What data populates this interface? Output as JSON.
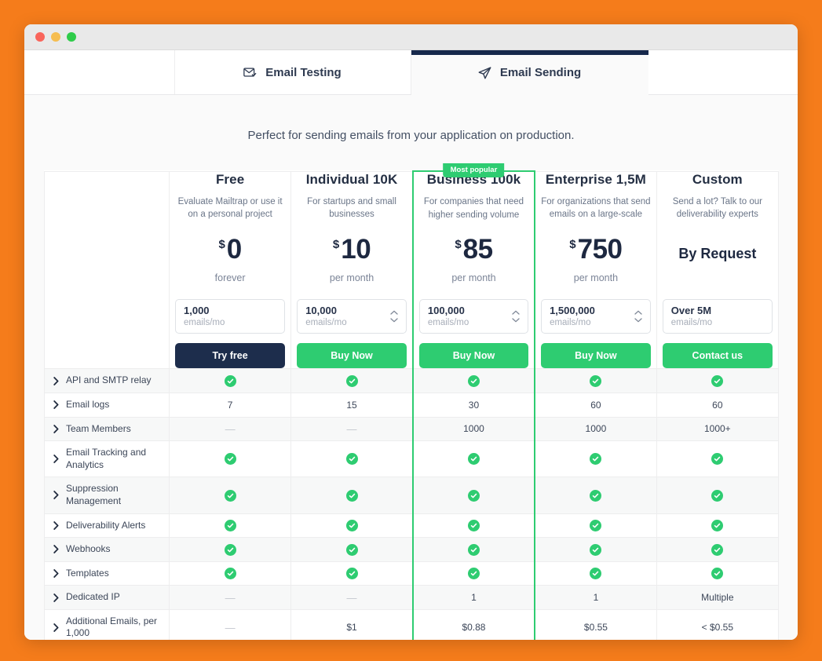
{
  "window": {
    "traffic_lights": [
      "close",
      "minimize",
      "maximize"
    ]
  },
  "tabs": [
    {
      "label": "Email Testing",
      "icon": "mail-check-icon",
      "active": false
    },
    {
      "label": "Email Sending",
      "icon": "paper-plane-icon",
      "active": true
    }
  ],
  "subtitle": "Perfect for sending emails from your application on production.",
  "badge": {
    "label": "Most popular"
  },
  "colors": {
    "accent_green": "#2ECC71",
    "navy": "#1D2D4C",
    "page_background": "#F57C1B",
    "row_alt": "#F7F8F8"
  },
  "plans": [
    {
      "name": "Free",
      "description": "Evaluate Mailtrap or use it on a personal project",
      "currency": "$",
      "price": "0",
      "period": "forever",
      "by_request": "",
      "quantity_value": "1,000",
      "quantity_placeholder": "emails/mo",
      "has_spinner": false,
      "cta_label": "Try free",
      "cta_style": "navy",
      "highlighted": false
    },
    {
      "name": "Individual 10K",
      "description": "For startups and small businesses",
      "currency": "$",
      "price": "10",
      "period": "per month",
      "by_request": "",
      "quantity_value": "10,000",
      "quantity_placeholder": "emails/mo",
      "has_spinner": true,
      "cta_label": "Buy Now",
      "cta_style": "green",
      "highlighted": false
    },
    {
      "name": "Business 100k",
      "description": "For companies that need higher sending volume",
      "currency": "$",
      "price": "85",
      "period": "per month",
      "by_request": "",
      "quantity_value": "100,000",
      "quantity_placeholder": "emails/mo",
      "has_spinner": true,
      "cta_label": "Buy Now",
      "cta_style": "green",
      "highlighted": true
    },
    {
      "name": "Enterprise 1,5M",
      "description": "For organizations that send emails on a large-scale",
      "currency": "$",
      "price": "750",
      "period": "per month",
      "by_request": "",
      "quantity_value": "1,500,000",
      "quantity_placeholder": "emails/mo",
      "has_spinner": true,
      "cta_label": "Buy Now",
      "cta_style": "green",
      "highlighted": false
    },
    {
      "name": "Custom",
      "description": "Send a lot? Talk to our deliverability experts",
      "currency": "",
      "price": "",
      "period": "",
      "by_request": "By Request",
      "quantity_value": "Over 5M",
      "quantity_placeholder": "emails/mo",
      "has_spinner": false,
      "cta_label": "Contact us",
      "cta_style": "green",
      "highlighted": false
    }
  ],
  "features": [
    {
      "label": "API and SMTP relay",
      "values": [
        "check",
        "check",
        "check",
        "check",
        "check"
      ]
    },
    {
      "label": "Email logs",
      "values": [
        "7",
        "15",
        "30",
        "60",
        "60"
      ]
    },
    {
      "label": "Team Members",
      "values": [
        "dash",
        "dash",
        "1000",
        "1000",
        "1000+"
      ]
    },
    {
      "label": "Email Tracking and Analytics",
      "values": [
        "check",
        "check",
        "check",
        "check",
        "check"
      ]
    },
    {
      "label": "Suppression Management",
      "values": [
        "check",
        "check",
        "check",
        "check",
        "check"
      ]
    },
    {
      "label": "Deliverability Alerts",
      "values": [
        "check",
        "check",
        "check",
        "check",
        "check"
      ]
    },
    {
      "label": "Webhooks",
      "values": [
        "check",
        "check",
        "check",
        "check",
        "check"
      ]
    },
    {
      "label": "Templates",
      "values": [
        "check",
        "check",
        "check",
        "check",
        "check"
      ]
    },
    {
      "label": "Dedicated IP",
      "values": [
        "dash",
        "dash",
        "1",
        "1",
        "Multiple"
      ]
    },
    {
      "label": "Additional Emails, per 1,000",
      "values": [
        "dash",
        "$1",
        "$0.88",
        "$0.55",
        "< $0.55"
      ]
    }
  ]
}
